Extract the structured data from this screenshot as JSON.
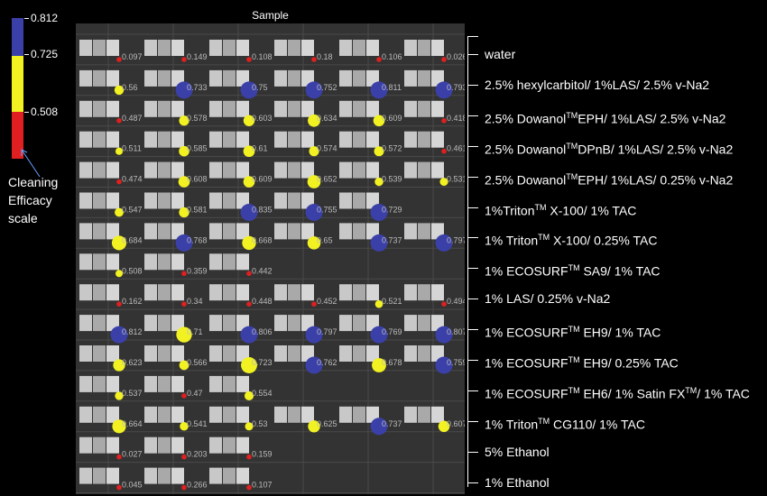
{
  "panel_title": "Sample",
  "scale": {
    "ticks": [
      "0.812",
      "0.725",
      "0.508"
    ],
    "caption": [
      "Cleaning",
      "Efficacy",
      "scale"
    ],
    "colors": {
      "high": "#3a40a8",
      "mid": "#f2f222",
      "low": "#e02020"
    }
  },
  "chart_data": {
    "type": "scatter",
    "title": "Sample",
    "columns": 6,
    "rows": [
      {
        "label": "water",
        "values": [
          0.097,
          0.149,
          0.108,
          0.18,
          0.106,
          0.026
        ]
      },
      {
        "label_parts": [
          "2.5% hexylcarbitol/ 1%LAS/ 2.5% v-Na2"
        ],
        "values": [
          0.56,
          0.733,
          0.75,
          0.752,
          0.811,
          0.793
        ]
      },
      {
        "label_parts": [
          "2.5% Dowanol",
          "TM",
          "EPH/ 1%LAS/ 2.5% v-Na2"
        ],
        "values": [
          0.487,
          0.578,
          0.603,
          0.634,
          0.609,
          0.418
        ]
      },
      {
        "label_parts": [
          "2.5% Dowanol",
          "TM",
          "DPnB/ 1%LAS/ 2.5% v-Na2"
        ],
        "values": [
          0.511,
          0.585,
          0.61,
          0.574,
          0.572,
          0.461
        ]
      },
      {
        "label_parts": [
          "2.5% Dowanol",
          "TM",
          "EPH/ 1%LAS/ 0.25% v-Na2"
        ],
        "values": [
          0.474,
          0.608,
          0.609,
          0.652,
          0.539,
          0.531
        ]
      },
      {
        "label_parts": [
          "1%Triton",
          "TM",
          " X-100/ 1% TAC"
        ],
        "values": [
          0.547,
          0.581,
          0.835,
          0.755,
          0.729,
          null
        ]
      },
      {
        "label_parts": [
          "1% Triton",
          "TM",
          " X-100/ 0.25% TAC"
        ],
        "values": [
          0.684,
          0.768,
          0.668,
          0.65,
          0.737,
          0.797
        ]
      },
      {
        "label_parts": [
          "1% ECOSURF",
          "TM",
          "  SA9/ 1% TAC"
        ],
        "values": [
          0.508,
          0.359,
          0.442,
          null,
          null,
          null
        ]
      },
      {
        "label_parts": [
          "1% LAS/ 0.25% v-Na2"
        ],
        "values": [
          0.162,
          0.34,
          0.448,
          0.452,
          0.521,
          0.494
        ]
      },
      {
        "label_parts": [
          "1% ECOSURF",
          "TM",
          " EH9/ 1% TAC"
        ],
        "values": [
          0.812,
          0.71,
          0.806,
          0.797,
          0.769,
          0.807
        ]
      },
      {
        "label_parts": [
          "1% ECOSURF",
          "TM",
          " EH9/ 0.25% TAC"
        ],
        "values": [
          0.623,
          0.566,
          0.723,
          0.762,
          0.678,
          0.759
        ]
      },
      {
        "label_parts": [
          "1% ECOSURF",
          "TM",
          " EH6/ 1% Satin FX",
          "TM",
          "/ 1% TAC"
        ],
        "values": [
          0.537,
          0.47,
          0.554,
          null,
          null,
          null
        ]
      },
      {
        "label_parts": [
          "1% Triton",
          "TM",
          " CG110/ 1% TAC"
        ],
        "values": [
          0.664,
          0.541,
          0.53,
          0.625,
          0.737,
          0.607
        ]
      },
      {
        "label": "5% Ethanol",
        "values": [
          0.027,
          0.203,
          0.159,
          null,
          null,
          null
        ]
      },
      {
        "label": "1% Ethanol",
        "values": [
          0.045,
          0.266,
          0.107,
          null,
          null,
          null
        ]
      }
    ]
  }
}
